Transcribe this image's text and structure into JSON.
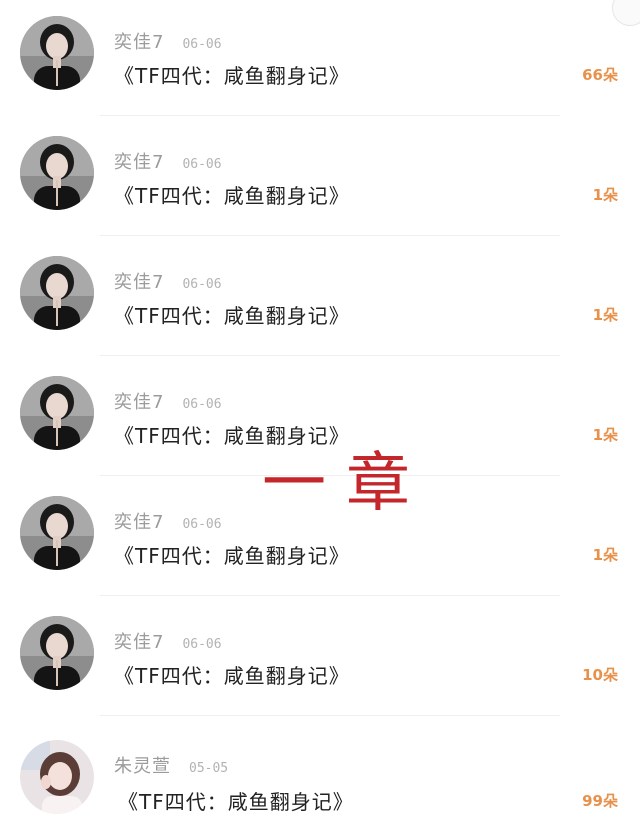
{
  "rows": [
    {
      "name": "奕佳7",
      "date": "06-06",
      "title": "《TF四代：咸鱼翻身记》",
      "count": "66朵",
      "avatar": "avatar-dark-hair-black-top"
    },
    {
      "name": "奕佳7",
      "date": "06-06",
      "title": "《TF四代：咸鱼翻身记》",
      "count": "1朵",
      "avatar": "avatar-dark-hair-black-top"
    },
    {
      "name": "奕佳7",
      "date": "06-06",
      "title": "《TF四代：咸鱼翻身记》",
      "count": "1朵",
      "avatar": "avatar-dark-hair-black-top"
    },
    {
      "name": "奕佳7",
      "date": "06-06",
      "title": "《TF四代：咸鱼翻身记》",
      "count": "1朵",
      "avatar": "avatar-dark-hair-black-top"
    },
    {
      "name": "奕佳7",
      "date": "06-06",
      "title": "《TF四代：咸鱼翻身记》",
      "count": "1朵",
      "avatar": "avatar-dark-hair-black-top"
    },
    {
      "name": "奕佳7",
      "date": "06-06",
      "title": "《TF四代：咸鱼翻身记》",
      "count": "10朵",
      "avatar": "avatar-dark-hair-black-top"
    },
    {
      "name": "朱灵萱",
      "date": "05-05",
      "title": "《TF四代：咸鱼翻身记》",
      "count": "99朵",
      "avatar": "avatar-light-portrait"
    }
  ],
  "overlay_text": "一章",
  "colors": {
    "name": "#9b9b9b",
    "date": "#b3b3b3",
    "title": "#222222",
    "count": "#e8914a",
    "overlay": "#c4272b"
  }
}
